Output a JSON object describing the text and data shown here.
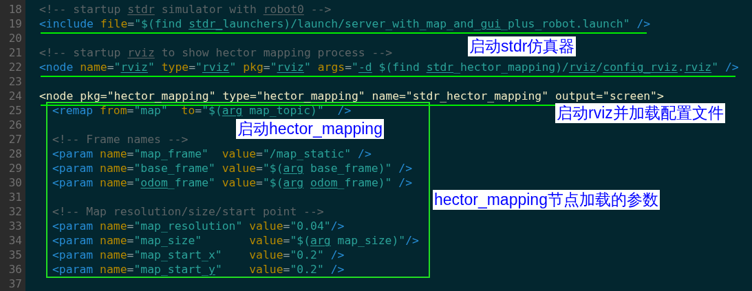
{
  "lines": [
    {
      "number": "18",
      "tokens": [
        {
          "kind": "comment",
          "text": "<!-- startup "
        },
        {
          "kind": "comment",
          "text": "stdr",
          "misspelled": true
        },
        {
          "kind": "comment",
          "text": " simulator with "
        },
        {
          "kind": "comment",
          "text": "robot0",
          "misspelled": true
        },
        {
          "kind": "comment",
          "text": " -->"
        }
      ]
    },
    {
      "number": "19",
      "marked": true,
      "tokens": [
        {
          "kind": "tag",
          "text": "<include "
        },
        {
          "kind": "attr",
          "text": "file"
        },
        {
          "kind": "plain",
          "text": "="
        },
        {
          "kind": "string",
          "text": "\"$(find "
        },
        {
          "kind": "string",
          "text": "stdr_",
          "misspelled": true
        },
        {
          "kind": "string",
          "text": "launchers)/launch/server_with_map_and_"
        },
        {
          "kind": "string",
          "text": "gui",
          "misspelled": true
        },
        {
          "kind": "string",
          "text": "_plus_robot.launch\" "
        },
        {
          "kind": "tag",
          "text": "/>"
        }
      ]
    },
    {
      "number": "20"
    },
    {
      "number": "21",
      "tokens": [
        {
          "kind": "comment",
          "text": "<!-- startup "
        },
        {
          "kind": "comment",
          "text": "rviz",
          "misspelled": true
        },
        {
          "kind": "comment",
          "text": " to show hector mapping process -->"
        }
      ]
    },
    {
      "number": "22",
      "marked": true,
      "tokens": [
        {
          "kind": "tag",
          "text": "<node "
        },
        {
          "kind": "attr",
          "text": "name"
        },
        {
          "kind": "plain",
          "text": "="
        },
        {
          "kind": "string",
          "text": "\""
        },
        {
          "kind": "string",
          "text": "rviz",
          "misspelled": true
        },
        {
          "kind": "string",
          "text": "\" "
        },
        {
          "kind": "attr",
          "text": "type"
        },
        {
          "kind": "plain",
          "text": "="
        },
        {
          "kind": "string",
          "text": "\""
        },
        {
          "kind": "string",
          "text": "rviz",
          "misspelled": true
        },
        {
          "kind": "string",
          "text": "\" "
        },
        {
          "kind": "attr",
          "text": "pkg"
        },
        {
          "kind": "plain",
          "text": "="
        },
        {
          "kind": "string",
          "text": "\""
        },
        {
          "kind": "string",
          "text": "rviz",
          "misspelled": true
        },
        {
          "kind": "string",
          "text": "\" "
        },
        {
          "kind": "attr",
          "text": "args"
        },
        {
          "kind": "plain",
          "text": "="
        },
        {
          "kind": "string",
          "text": "\""
        },
        {
          "kind": "string",
          "text": "-d",
          "misspelled": true
        },
        {
          "kind": "string",
          "text": " $(find "
        },
        {
          "kind": "string",
          "text": "stdr",
          "misspelled": true
        },
        {
          "kind": "string",
          "text": "_hector_mapping)/"
        },
        {
          "kind": "string",
          "text": "rviz",
          "misspelled": true
        },
        {
          "kind": "string",
          "text": "/"
        },
        {
          "kind": "string",
          "text": "config_rviz",
          "misspelled": true
        },
        {
          "kind": "string",
          "text": "."
        },
        {
          "kind": "string",
          "text": "rviz",
          "misspelled": true
        },
        {
          "kind": "string",
          "text": "\" "
        },
        {
          "kind": "tag",
          "text": "/>"
        }
      ]
    },
    {
      "number": "23"
    },
    {
      "number": "24",
      "marked": true,
      "tokens": [
        {
          "kind": "unparsed",
          "text": "<node pkg=\"hector_mapping\" type=\"hector_mapping\" name=\"stdr_hector_mapping\" output=\"screen\">"
        }
      ],
      "children": [
        {
          "number": "25",
          "tokens": [
            {
              "kind": "tag",
              "text": "<remap "
            },
            {
              "kind": "attr",
              "text": "from"
            },
            {
              "kind": "plain",
              "text": "="
            },
            {
              "kind": "string",
              "text": "\"map\"  "
            },
            {
              "kind": "attr",
              "text": "to"
            },
            {
              "kind": "plain",
              "text": "="
            },
            {
              "kind": "string",
              "text": "\"$("
            },
            {
              "kind": "string",
              "text": "arg",
              "misspelled": true
            },
            {
              "kind": "string",
              "text": " map_topic)\"  "
            },
            {
              "kind": "tag",
              "text": "/>"
            }
          ]
        },
        {
          "number": "26"
        },
        {
          "number": "27",
          "tokens": [
            {
              "kind": "comment",
              "text": "<!-- Frame names -->"
            }
          ]
        },
        {
          "number": "28",
          "tokens": [
            {
              "kind": "tag",
              "text": "<param "
            },
            {
              "kind": "attr",
              "text": "name"
            },
            {
              "kind": "plain",
              "text": "="
            },
            {
              "kind": "string",
              "text": "\"map_frame\"  "
            },
            {
              "kind": "attr",
              "text": "value"
            },
            {
              "kind": "plain",
              "text": "="
            },
            {
              "kind": "string",
              "text": "\"/map_static\" "
            },
            {
              "kind": "tag",
              "text": "/>"
            }
          ]
        },
        {
          "number": "29",
          "tokens": [
            {
              "kind": "tag",
              "text": "<param "
            },
            {
              "kind": "attr",
              "text": "name"
            },
            {
              "kind": "plain",
              "text": "="
            },
            {
              "kind": "string",
              "text": "\"base_frame\" "
            },
            {
              "kind": "attr",
              "text": "value"
            },
            {
              "kind": "plain",
              "text": "="
            },
            {
              "kind": "string",
              "text": "\"$("
            },
            {
              "kind": "string",
              "text": "arg",
              "misspelled": true
            },
            {
              "kind": "string",
              "text": " base_frame)\" "
            },
            {
              "kind": "tag",
              "text": "/>"
            }
          ]
        },
        {
          "number": "30",
          "tokens": [
            {
              "kind": "tag",
              "text": "<param "
            },
            {
              "kind": "attr",
              "text": "name"
            },
            {
              "kind": "plain",
              "text": "="
            },
            {
              "kind": "string",
              "text": "\""
            },
            {
              "kind": "string",
              "text": "odom",
              "misspelled": true
            },
            {
              "kind": "string",
              "text": "_frame\" "
            },
            {
              "kind": "attr",
              "text": "value"
            },
            {
              "kind": "plain",
              "text": "="
            },
            {
              "kind": "string",
              "text": "\"$("
            },
            {
              "kind": "string",
              "text": "arg",
              "misspelled": true
            },
            {
              "kind": "string",
              "text": " odom",
              "misspelled": true
            },
            {
              "kind": "string",
              "text": "_frame)\" "
            },
            {
              "kind": "tag",
              "text": "/>"
            }
          ]
        },
        {
          "number": "31"
        },
        {
          "number": "32",
          "tokens": [
            {
              "kind": "comment",
              "text": "<!-- Map resolution/size/start point -->"
            }
          ]
        },
        {
          "number": "33",
          "tokens": [
            {
              "kind": "tag",
              "text": "<param "
            },
            {
              "kind": "attr",
              "text": "name"
            },
            {
              "kind": "plain",
              "text": "="
            },
            {
              "kind": "string",
              "text": "\"map_resolution\" "
            },
            {
              "kind": "attr",
              "text": "value"
            },
            {
              "kind": "plain",
              "text": "="
            },
            {
              "kind": "string",
              "text": "\"0.04\""
            },
            {
              "kind": "tag",
              "text": "/>"
            }
          ]
        },
        {
          "number": "34",
          "tokens": [
            {
              "kind": "tag",
              "text": "<param "
            },
            {
              "kind": "attr",
              "text": "name"
            },
            {
              "kind": "plain",
              "text": "="
            },
            {
              "kind": "string",
              "text": "\"map_size\"       "
            },
            {
              "kind": "attr",
              "text": "value"
            },
            {
              "kind": "plain",
              "text": "="
            },
            {
              "kind": "string",
              "text": "\"$("
            },
            {
              "kind": "string",
              "text": "arg",
              "misspelled": true
            },
            {
              "kind": "string",
              "text": " map_size)\""
            },
            {
              "kind": "tag",
              "text": "/>"
            }
          ]
        },
        {
          "number": "35",
          "tokens": [
            {
              "kind": "tag",
              "text": "<param "
            },
            {
              "kind": "attr",
              "text": "name"
            },
            {
              "kind": "plain",
              "text": "="
            },
            {
              "kind": "string",
              "text": "\"map_start_x\"    "
            },
            {
              "kind": "attr",
              "text": "value"
            },
            {
              "kind": "plain",
              "text": "="
            },
            {
              "kind": "string",
              "text": "\"0.2\" "
            },
            {
              "kind": "tag",
              "text": "/>"
            }
          ]
        },
        {
          "number": "36",
          "tokens": [
            {
              "kind": "tag",
              "text": "<param "
            },
            {
              "kind": "attr",
              "text": "name"
            },
            {
              "kind": "plain",
              "text": "="
            },
            {
              "kind": "string",
              "text": "\"map_start_"
            },
            {
              "kind": "string",
              "text": "y",
              "misspelled": true
            },
            {
              "kind": "string",
              "text": "\"    "
            },
            {
              "kind": "attr",
              "text": "value"
            },
            {
              "kind": "plain",
              "text": "="
            },
            {
              "kind": "string",
              "text": "\"0.2\" "
            },
            {
              "kind": "tag",
              "text": "/>"
            }
          ]
        }
      ]
    },
    {
      "number": "37"
    }
  ],
  "annotations": [
    {
      "text": "启动stdr仿真器"
    },
    {
      "text": "启动rviz并加载配置文件"
    },
    {
      "text": "启动hector_mapping"
    },
    {
      "text": "hector_mapping节点加载的参数"
    }
  ]
}
